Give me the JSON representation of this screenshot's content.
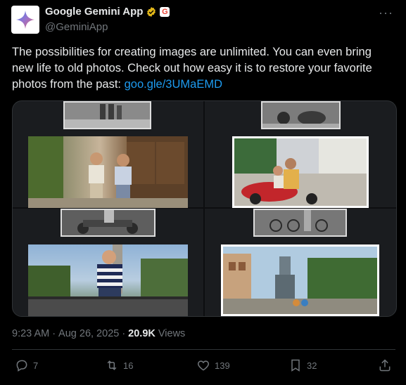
{
  "author": {
    "display_name": "Google Gemini App",
    "handle": "@GeminiApp",
    "badge_letter": "G",
    "verified_color": "#e2b719"
  },
  "more_label": "···",
  "post": {
    "text": "The possibilities for creating images are unlimited. You can even bring new life to old photos. Check out how easy it is to restore your favorite photos from the past: ",
    "link": "goo.gle/3UMaEMD"
  },
  "meta": {
    "time": "9:23 AM",
    "dot": "·",
    "date": "Aug 26, 2025",
    "dot2": "·",
    "views_count": "20.9K",
    "views_label": "Views"
  },
  "actions": {
    "replies": "7",
    "reposts": "16",
    "likes": "139",
    "bookmarks": "32"
  },
  "icons": {
    "reply": "reply-icon",
    "repost": "repost-icon",
    "like": "like-icon",
    "bookmark": "bookmark-icon",
    "share": "share-icon"
  },
  "colors": {
    "link": "#1d9bf0",
    "muted": "#71767b",
    "text": "#e7e9ea",
    "background": "#000000"
  }
}
